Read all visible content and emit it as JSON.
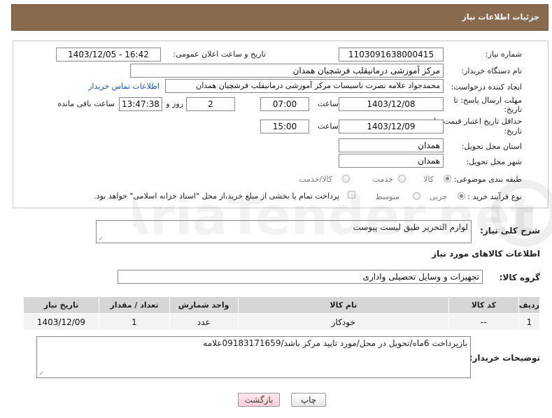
{
  "header": {
    "title": "جزئیات اطلاعات نیاز"
  },
  "form": {
    "need_number_label": "شماره نیاز:",
    "need_number": "1103091638000415",
    "announce_label": "تاریخ و ساعت اعلان عمومی:",
    "announce_value": "1403/12/05 - 16:42",
    "buyer_label": "نام دستگاه خریدار:",
    "buyer_value": "مرکز آموزشی درمانیقلب فرشچیان همدان",
    "creator_label": "ایجاد کننده درخواست:",
    "creator_value": "محمدجواد علامه نصرت تاسیسات مرکز آموزشی درمانیقلب فرشچیان همدان",
    "contact_link": "اطلاعات تماس خریدار",
    "reply_deadline_label_1": "مهلت ارسال پاسخ: تا",
    "reply_deadline_label_2": "تاریخ:",
    "reply_date": "1403/12/08",
    "time_label": "ساعت",
    "reply_time": "07:00",
    "days_value": "2",
    "days_label": "روز و",
    "remaining_time": "13:47:38",
    "remaining_label": "ساعت باقی مانده",
    "price_validity_label_1": "حداقل تاریخ اعتبار قیمت: تا",
    "price_validity_label_2": "تاریخ:",
    "validity_date": "1403/12/09",
    "validity_time": "15:00",
    "province_label": "استان محل تحویل:",
    "province_value": "همدان",
    "city_label": "شهر محل تحویل:",
    "city_value": "همدان",
    "category_label": "طبقه بندی موضوعی:",
    "category_options": [
      "کالا",
      "خدمت",
      "کالا/خدمت"
    ],
    "purchase_type_label": "نوع فرآیند خرید :",
    "purchase_options": [
      "جزیی",
      "متوسط"
    ],
    "payment_note": "پرداخت تمام یا بخشی از مبلغ خرید،از محل \"اسناد خزانه اسلامی\" خواهد بود."
  },
  "description": {
    "label": "شرح کلی نیاز:",
    "value": "لوازم التحریر طبق لیست پیوست"
  },
  "goods_info": {
    "title": "اطلاعات کالاهای مورد نیاز",
    "group_label": "گروه کالا:",
    "group_value": "تجهیزات و وسایل تحصیلی واداری"
  },
  "table": {
    "headers": [
      "ردیف",
      "کد کالا",
      "نام کالا",
      "واحد شمارش",
      "تعداد / مقدار",
      "تاریخ نیاز"
    ],
    "rows": [
      [
        "1",
        "--",
        "خودکار",
        "عدد",
        "1",
        "1403/12/09"
      ]
    ]
  },
  "buyer_notes": {
    "label": "توضیحات خریدار:",
    "value": "بازپرداخت 6ماه/تحویل در محل/مورد تایید مرکز باشد/09183171659علامه"
  },
  "buttons": {
    "print": "چاپ",
    "back": "بازگشت"
  },
  "watermark": "AriaTender.net",
  "colors": {
    "header_bg": "#8a6a4e",
    "link": "#1a56c9",
    "table_header": "#d6d6d6"
  }
}
